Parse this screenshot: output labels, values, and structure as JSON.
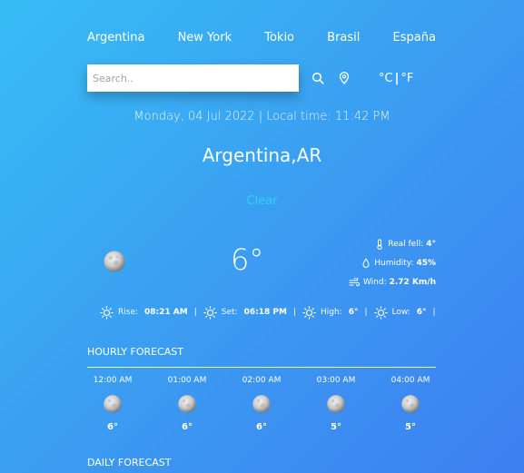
{
  "cities": [
    "Argentina",
    "New York",
    "Tokio",
    "Brasil",
    "España"
  ],
  "search": {
    "placeholder": "Search.."
  },
  "units": {
    "celsius": "°C",
    "separator": "|",
    "fahrenheit": "°F"
  },
  "datetime": "Monday, 04 Jul 2022 | Local time: 11:42 PM",
  "location": "Argentina,AR",
  "condition": "Clear",
  "current": {
    "temp": "6°",
    "details": [
      {
        "label": "Real fell:",
        "value": "4°",
        "icon": "thermometer-icon"
      },
      {
        "label": "Humidity:",
        "value": "45%",
        "icon": "droplet-icon"
      },
      {
        "label": "Wind:",
        "value": "2.72 Km/h",
        "icon": "wind-icon"
      }
    ]
  },
  "sun": {
    "rise_label": "Rise:",
    "rise": "08:21 AM",
    "set_label": "Set:",
    "set": "06:18 PM",
    "high_label": "High:",
    "high": "6°",
    "low_label": "Low:",
    "low": "6°",
    "separator": "|"
  },
  "hourly_title": "HOURLY FORECAST",
  "hourly": [
    {
      "time": "12:00 AM",
      "temp": "6°"
    },
    {
      "time": "01:00 AM",
      "temp": "6°"
    },
    {
      "time": "02:00 AM",
      "temp": "6°"
    },
    {
      "time": "03:00 AM",
      "temp": "5°"
    },
    {
      "time": "04:00 AM",
      "temp": "5°"
    }
  ],
  "daily_title": "DAILY FORECAST",
  "colors": {
    "bg_start": "#37bdf5",
    "bg_end": "#3d7ff0",
    "condition": "#2fd3ef"
  }
}
